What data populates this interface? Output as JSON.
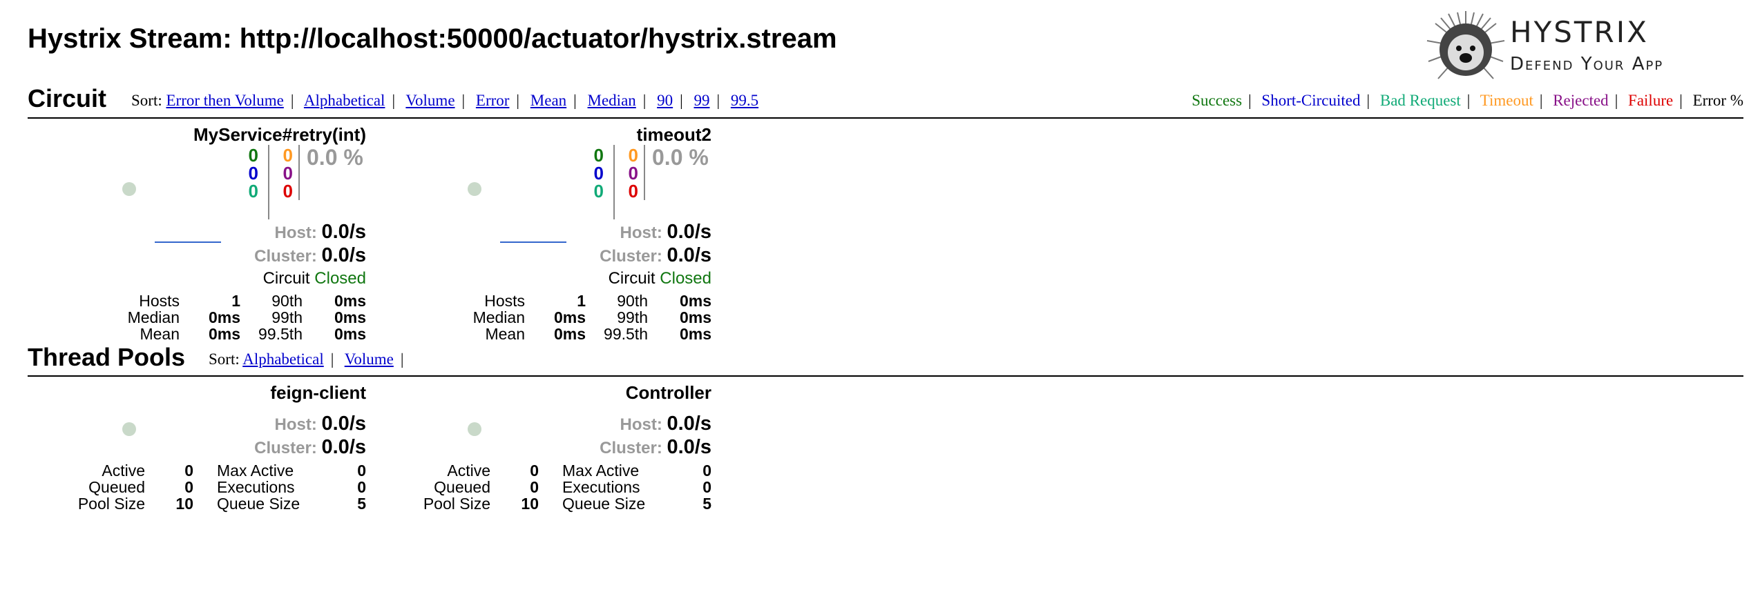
{
  "header": {
    "title": "Hystrix Stream: http://localhost:50000/actuator/hystrix.stream"
  },
  "logo": {
    "line1": "HYSTRIX",
    "line2": "Defend Your App"
  },
  "circuit_section": {
    "title": "Circuit",
    "sort_label": "Sort:",
    "sort_options": [
      "Error then Volume",
      "Alphabetical",
      "Volume",
      "Error",
      "Mean",
      "Median",
      "90",
      "99",
      "99.5"
    ]
  },
  "legend": [
    {
      "label": "Success",
      "color": "#117711"
    },
    {
      "label": "Short-Circuited",
      "color": "#0000cc"
    },
    {
      "label": "Bad Request",
      "color": "#11aa77"
    },
    {
      "label": "Timeout",
      "color": "#ff9922"
    },
    {
      "label": "Rejected",
      "color": "#881188"
    },
    {
      "label": "Failure",
      "color": "#dd0000"
    },
    {
      "label": "Error %",
      "color": "#000000"
    }
  ],
  "circuits": [
    {
      "name": "MyService#retry(int)",
      "counts": {
        "success": "0",
        "short_circuited": "0",
        "bad_request": "0",
        "timeout": "0",
        "rejected": "0",
        "failure": "0"
      },
      "error_pct": "0.0 %",
      "host_label": "Host:",
      "host_rate": "0.0/s",
      "cluster_label": "Cluster:",
      "cluster_rate": "0.0/s",
      "circuit_label": "Circuit",
      "circuit_status": "Closed",
      "stats": {
        "hosts_label": "Hosts",
        "hosts": "1",
        "median_label": "Median",
        "median": "0ms",
        "mean_label": "Mean",
        "mean": "0ms",
        "p90_label": "90th",
        "p90": "0ms",
        "p99_label": "99th",
        "p99": "0ms",
        "p995_label": "99.5th",
        "p995": "0ms"
      }
    },
    {
      "name": "timeout2",
      "counts": {
        "success": "0",
        "short_circuited": "0",
        "bad_request": "0",
        "timeout": "0",
        "rejected": "0",
        "failure": "0"
      },
      "error_pct": "0.0 %",
      "host_label": "Host:",
      "host_rate": "0.0/s",
      "cluster_label": "Cluster:",
      "cluster_rate": "0.0/s",
      "circuit_label": "Circuit",
      "circuit_status": "Closed",
      "stats": {
        "hosts_label": "Hosts",
        "hosts": "1",
        "median_label": "Median",
        "median": "0ms",
        "mean_label": "Mean",
        "mean": "0ms",
        "p90_label": "90th",
        "p90": "0ms",
        "p99_label": "99th",
        "p99": "0ms",
        "p995_label": "99.5th",
        "p995": "0ms"
      }
    }
  ],
  "threadpool_section": {
    "title": "Thread Pools",
    "sort_label": "Sort:",
    "sort_options": [
      "Alphabetical",
      "Volume"
    ]
  },
  "threadpools": [
    {
      "name": "feign-client",
      "host_label": "Host:",
      "host_rate": "0.0/s",
      "cluster_label": "Cluster:",
      "cluster_rate": "0.0/s",
      "stats": {
        "active_label": "Active",
        "active": "0",
        "queued_label": "Queued",
        "queued": "0",
        "pool_size_label": "Pool Size",
        "pool_size": "10",
        "max_active_label": "Max Active",
        "max_active": "0",
        "executions_label": "Executions",
        "executions": "0",
        "queue_size_label": "Queue Size",
        "queue_size": "5"
      }
    },
    {
      "name": "Controller",
      "host_label": "Host:",
      "host_rate": "0.0/s",
      "cluster_label": "Cluster:",
      "cluster_rate": "0.0/s",
      "stats": {
        "active_label": "Active",
        "active": "0",
        "queued_label": "Queued",
        "queued": "0",
        "pool_size_label": "Pool Size",
        "pool_size": "10",
        "max_active_label": "Max Active",
        "max_active": "0",
        "executions_label": "Executions",
        "executions": "0",
        "queue_size_label": "Queue Size",
        "queue_size": "5"
      }
    }
  ],
  "colors": {
    "success": "#117711",
    "short_circuited": "#0000cc",
    "bad_request": "#11aa77",
    "timeout": "#ff9922",
    "rejected": "#881188",
    "failure": "#dd0000",
    "closed": "#117711",
    "muted": "#999999"
  }
}
